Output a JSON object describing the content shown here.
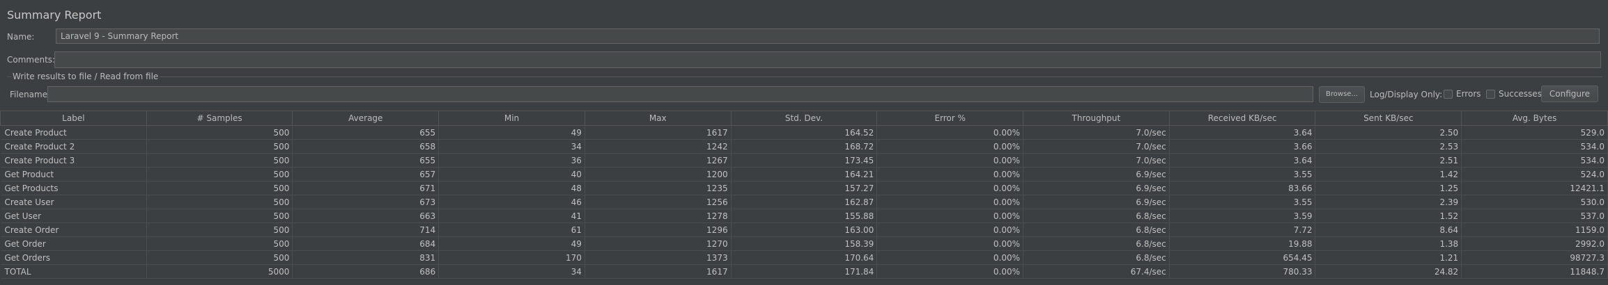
{
  "title": "Summary Report",
  "name_label": "Name:",
  "name_value": "Laravel 9 - Summary Report",
  "comments_label": "Comments:",
  "comments_value": "",
  "group_title": "Write results to file / Read from file",
  "filename_label": "Filename",
  "filename_value": "",
  "browse_label": "Browse...",
  "log_display_label": "Log/Display Only:",
  "errors_label": "Errors",
  "successes_label": "Successes",
  "configure_label": "Configure",
  "table": {
    "columns": [
      "Label",
      "# Samples",
      "Average",
      "Min",
      "Max",
      "Std. Dev.",
      "Error %",
      "Throughput",
      "Received KB/sec",
      "Sent KB/sec",
      "Avg. Bytes"
    ],
    "rows": [
      [
        "Create Product",
        "500",
        "655",
        "49",
        "1617",
        "164.52",
        "0.00%",
        "7.0/sec",
        "3.64",
        "2.50",
        "529.0"
      ],
      [
        "Create Product 2",
        "500",
        "658",
        "34",
        "1242",
        "168.72",
        "0.00%",
        "7.0/sec",
        "3.66",
        "2.53",
        "534.0"
      ],
      [
        "Create Product 3",
        "500",
        "655",
        "36",
        "1267",
        "173.45",
        "0.00%",
        "7.0/sec",
        "3.64",
        "2.51",
        "534.0"
      ],
      [
        "Get Product",
        "500",
        "657",
        "40",
        "1200",
        "164.21",
        "0.00%",
        "6.9/sec",
        "3.55",
        "1.42",
        "524.0"
      ],
      [
        "Get Products",
        "500",
        "671",
        "48",
        "1235",
        "157.27",
        "0.00%",
        "6.9/sec",
        "83.66",
        "1.25",
        "12421.1"
      ],
      [
        "Create User",
        "500",
        "673",
        "46",
        "1256",
        "162.87",
        "0.00%",
        "6.9/sec",
        "3.55",
        "2.39",
        "530.0"
      ],
      [
        "Get User",
        "500",
        "663",
        "41",
        "1278",
        "155.88",
        "0.00%",
        "6.8/sec",
        "3.59",
        "1.52",
        "537.0"
      ],
      [
        "Create Order",
        "500",
        "714",
        "61",
        "1296",
        "163.00",
        "0.00%",
        "6.8/sec",
        "7.72",
        "8.64",
        "1159.0"
      ],
      [
        "Get Order",
        "500",
        "684",
        "49",
        "1270",
        "158.39",
        "0.00%",
        "6.8/sec",
        "19.88",
        "1.38",
        "2992.0"
      ],
      [
        "Get Orders",
        "500",
        "831",
        "170",
        "1373",
        "170.64",
        "0.00%",
        "6.8/sec",
        "654.45",
        "1.21",
        "98727.3"
      ],
      [
        "TOTAL",
        "5000",
        "686",
        "34",
        "1617",
        "171.84",
        "0.00%",
        "67.4/sec",
        "780.33",
        "24.82",
        "11848.7"
      ]
    ]
  }
}
